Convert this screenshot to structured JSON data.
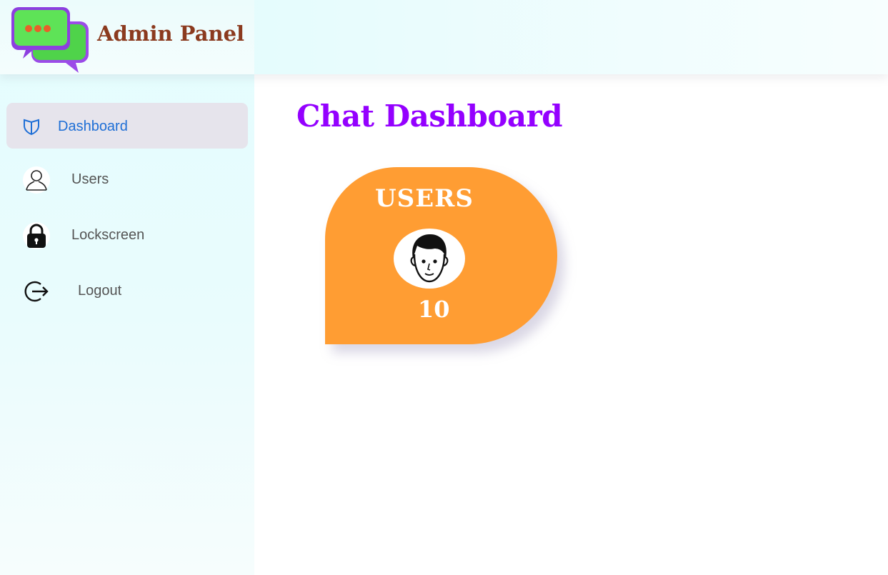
{
  "brand": {
    "name": "Admin Panel",
    "logo_icon": "chat-bubbles-icon"
  },
  "sidebar": {
    "items": [
      {
        "label": "Dashboard",
        "icon": "shield-icon",
        "active": true
      },
      {
        "label": "Users",
        "icon": "user-silhouette-icon"
      },
      {
        "label": "Lockscreen",
        "icon": "lock-icon"
      },
      {
        "label": "Logout",
        "icon": "logout-icon"
      }
    ]
  },
  "main": {
    "title": "Chat Dashboard",
    "cards": [
      {
        "title": "USERS",
        "icon": "face-icon",
        "count": "10"
      }
    ]
  },
  "colors": {
    "brand_text": "#8b3a1e",
    "title": "#9400ff",
    "card": "#ff9d33",
    "active_nav_bg": "#e6e4ec",
    "active_nav_text": "#1f6fd6"
  }
}
